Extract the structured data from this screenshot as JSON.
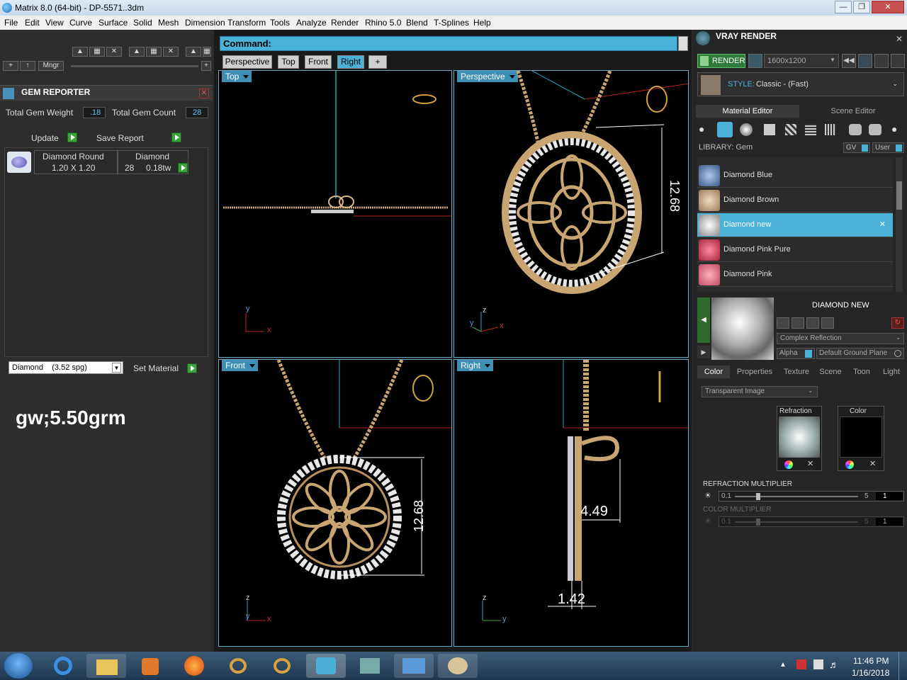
{
  "window": {
    "title": "Matrix 8.0 (64-bit) - DP-5571..3dm"
  },
  "menu": [
    "File",
    "Edit",
    "View",
    "Curve",
    "Surface",
    "Solid",
    "Mesh",
    "Dimension",
    "Transform",
    "Tools",
    "Analyze",
    "Render",
    "Rhino 5.0",
    "Blend",
    "T-Splines",
    "Help"
  ],
  "toolbar": {
    "mngr_label": "Mngr"
  },
  "gem_reporter": {
    "title": "GEM REPORTER",
    "total_weight_label": "Total Gem Weight",
    "total_weight_value": ".18",
    "total_count_label": "Total Gem Count",
    "total_count_value": "28",
    "update_label": "Update",
    "save_report_label": "Save Report",
    "row": {
      "shape": "Diamond Round",
      "size": "1.20 X 1.20",
      "material": "Diamond",
      "count": "28",
      "weight": "0.18tw"
    }
  },
  "material_select": {
    "value": "Diamond    (3.52 spg)",
    "set_label": "Set Material"
  },
  "note": "gw;5.50grm",
  "command": {
    "label": "Command:"
  },
  "view_tabs": [
    "Perspective",
    "Top",
    "Front",
    "Right",
    "+"
  ],
  "viewports": {
    "top": "Top",
    "perspective": "Perspective",
    "front": "Front",
    "right": "Right"
  },
  "dimensions": {
    "persp": "12.68",
    "front": "12.68",
    "right_w": "4.49",
    "right_t": "1.42"
  },
  "axes": {
    "x": "x",
    "y": "y",
    "z": "z"
  },
  "vray": {
    "title": "VRAY RENDER",
    "render_label": "RENDER",
    "resolution": "1600x1200",
    "style_label": "STYLE:",
    "style_value": "Classic - (Fast)",
    "tabs": [
      "Material Editor",
      "Scene Editor"
    ],
    "library_label": "LIBRARY: Gem",
    "gv_label": "GV",
    "user_label": "User",
    "library_items": [
      "Diamond Blue",
      "Diamond Brown",
      "Diamond new",
      "Diamond Pink Pure",
      "Diamond Pink"
    ],
    "selected_item": "Diamond new",
    "material_name": "DIAMOND NEW",
    "reflection": "Complex Reflection",
    "alpha_label": "Alpha",
    "ground": "Default Ground Plane",
    "prop_tabs": [
      "Color",
      "Properties",
      "Texture",
      "Scene",
      "Toon",
      "Light"
    ],
    "transparent": "Transparent Image",
    "refraction_label": "Refraction",
    "color_label": "Color",
    "refr_mult_label": "REFRACTION MULTIPLIER",
    "refr_min": "0.1",
    "refr_max": "5",
    "refr_val": "1",
    "color_mult_label": "COLOR MULTIPLIER",
    "color_min": "0.1",
    "color_max": "5",
    "color_val": "1"
  },
  "taskbar": {
    "time": "11:46 PM",
    "date": "1/16/2018"
  }
}
